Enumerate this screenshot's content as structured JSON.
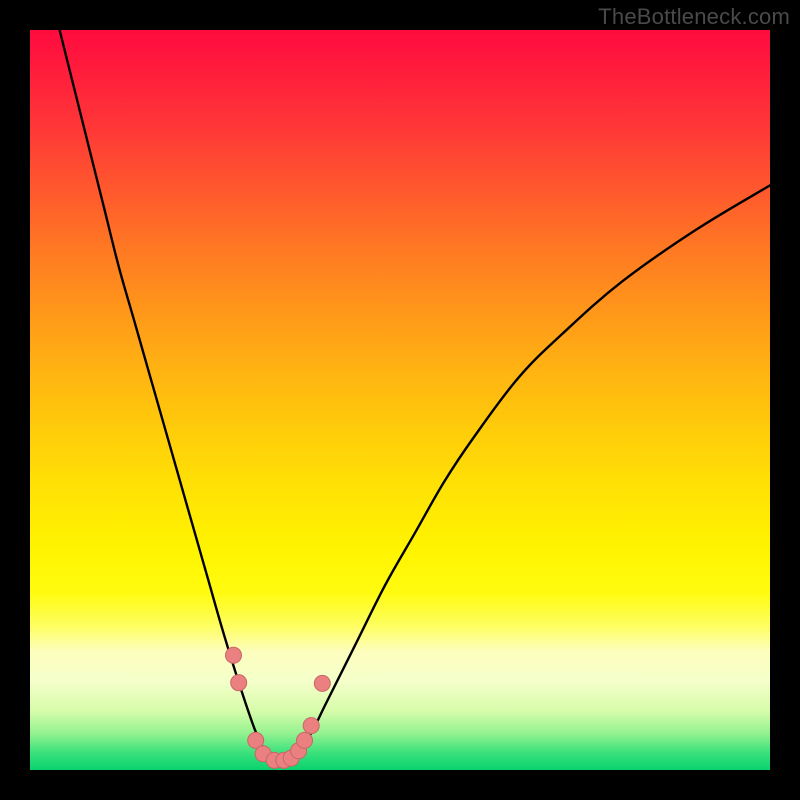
{
  "watermark": "TheBottleneck.com",
  "colors": {
    "frame": "#000000",
    "curve": "#000000",
    "marker_fill": "#ea8080",
    "marker_stroke": "#c96666",
    "gradient_top": "#ff0b3e",
    "gradient_bottom": "#08d36d"
  },
  "chart_data": {
    "type": "line",
    "title": "",
    "xlabel": "",
    "ylabel": "",
    "xlim": [
      0,
      100
    ],
    "ylim": [
      0,
      100
    ],
    "note": "Axis values are normalized percentages (no tick labels visible in image). y=0 is the bottom (good / green), y=100 is the top (bad / red). Curve values are visually estimated.",
    "series": [
      {
        "name": "bottleneck-curve",
        "x": [
          4,
          6,
          8,
          10,
          12,
          14,
          16,
          18,
          20,
          22,
          24,
          26,
          28,
          30,
          31,
          32,
          33,
          34,
          35,
          36,
          38,
          40,
          44,
          48,
          52,
          56,
          60,
          66,
          72,
          80,
          90,
          100
        ],
        "y": [
          100,
          92,
          84,
          76,
          68,
          61,
          54,
          47,
          40,
          33,
          26,
          19,
          12.5,
          6.5,
          4,
          2.2,
          1.3,
          1.1,
          1.3,
          2.2,
          5,
          9,
          17,
          25,
          32,
          39,
          45,
          53,
          59,
          66,
          73,
          79
        ]
      }
    ],
    "markers": {
      "name": "highlight-dots",
      "points_xy": [
        [
          27.5,
          15.5
        ],
        [
          28.2,
          11.8
        ],
        [
          30.5,
          4.0
        ],
        [
          31.5,
          2.2
        ],
        [
          33.0,
          1.3
        ],
        [
          34.3,
          1.3
        ],
        [
          35.3,
          1.6
        ],
        [
          36.3,
          2.6
        ],
        [
          37.1,
          4.0
        ],
        [
          38.0,
          6.0
        ],
        [
          39.5,
          11.7
        ]
      ],
      "radius_px": 8
    }
  }
}
